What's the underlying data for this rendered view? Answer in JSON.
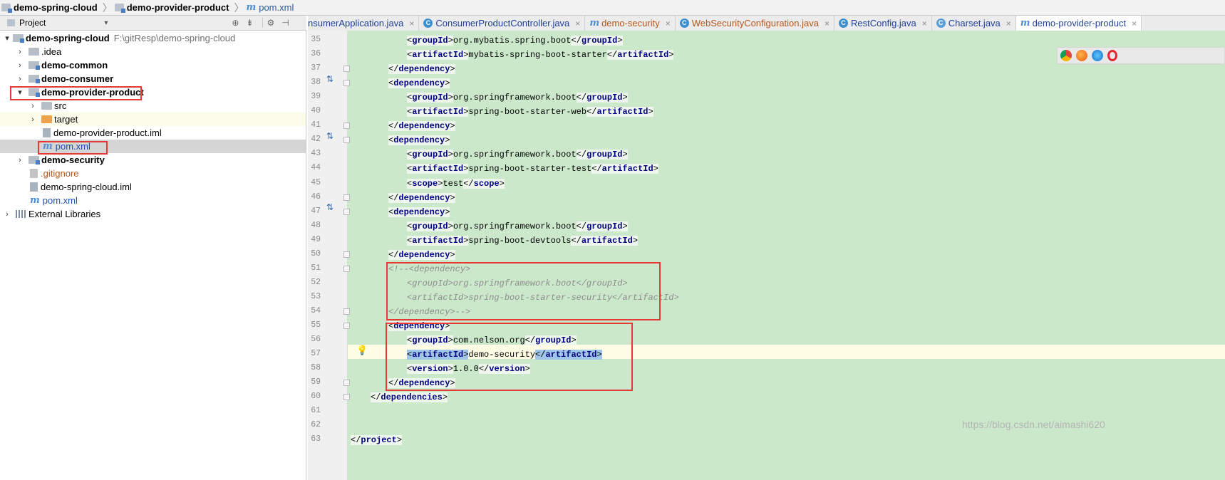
{
  "breadcrumb": {
    "items": [
      {
        "label": "demo-spring-cloud",
        "icon": "project-folder-icon"
      },
      {
        "label": "demo-provider-product",
        "icon": "module-folder-icon"
      },
      {
        "label": "pom.xml",
        "icon": "maven-file-icon"
      }
    ],
    "separator": "〉"
  },
  "project_panel": {
    "title": "Project",
    "dropdown_glyph": "▾",
    "toolbar_icons": [
      "target-icon",
      "collapse-icon",
      "gear-icon",
      "hide-panel-icon"
    ]
  },
  "tree": [
    {
      "label": "demo-spring-cloud",
      "suffix": "F:\\gitResp\\demo-spring-cloud",
      "arrow": "▾"
    },
    {
      "label": ".idea",
      "arrow": "›"
    },
    {
      "label": "demo-common",
      "arrow": "›"
    },
    {
      "label": "demo-consumer",
      "arrow": "›"
    },
    {
      "label": "demo-provider-product",
      "arrow": "▾"
    },
    {
      "label": "src",
      "arrow": "›"
    },
    {
      "label": "target",
      "arrow": "›"
    },
    {
      "label": "demo-provider-product.iml"
    },
    {
      "label": "pom.xml"
    },
    {
      "label": "demo-security",
      "arrow": "›"
    },
    {
      "label": ".gitignore"
    },
    {
      "label": "demo-spring-cloud.iml"
    },
    {
      "label": "pom.xml"
    },
    {
      "label": "External Libraries",
      "arrow": "›"
    }
  ],
  "tabs": [
    {
      "label": "nsumerApplication.java"
    },
    {
      "label": "ConsumerProductController.java"
    },
    {
      "label": "demo-security"
    },
    {
      "label": "WebSecurityConfiguration.java"
    },
    {
      "label": "RestConfig.java"
    },
    {
      "label": "Charset.java"
    },
    {
      "label": "demo-provider-product",
      "active": true
    }
  ],
  "tab_close_glyph": "×",
  "editor": {
    "lines": [
      {
        "n": "35",
        "parts": [
          [
            "i2",
            ""
          ],
          [
            "tag",
            "groupId"
          ],
          [
            "txt",
            "org.mybatis.spring.boot"
          ],
          [
            "ctag",
            "groupId"
          ]
        ]
      },
      {
        "n": "36",
        "parts": [
          [
            "i2",
            ""
          ],
          [
            "tag",
            "artifactId"
          ],
          [
            "txt",
            "mybatis-spring-boot-starter"
          ],
          [
            "ctag",
            "artifactId"
          ]
        ]
      },
      {
        "n": "37",
        "parts": [
          [
            "i1",
            ""
          ],
          [
            "ctag",
            "dependency"
          ]
        ]
      },
      {
        "n": "38",
        "parts": [
          [
            "i1",
            ""
          ],
          [
            "tag",
            "dependency"
          ]
        ]
      },
      {
        "n": "39",
        "parts": [
          [
            "i2",
            ""
          ],
          [
            "tag",
            "groupId"
          ],
          [
            "txt",
            "org.springframework.boot"
          ],
          [
            "ctag",
            "groupId"
          ]
        ]
      },
      {
        "n": "40",
        "parts": [
          [
            "i2",
            ""
          ],
          [
            "tag",
            "artifactId"
          ],
          [
            "txt",
            "spring-boot-starter-web"
          ],
          [
            "ctag",
            "artifactId"
          ]
        ]
      },
      {
        "n": "41",
        "parts": [
          [
            "i1",
            ""
          ],
          [
            "ctag",
            "dependency"
          ]
        ]
      },
      {
        "n": "42",
        "parts": [
          [
            "i1",
            ""
          ],
          [
            "tag",
            "dependency"
          ]
        ]
      },
      {
        "n": "43",
        "parts": [
          [
            "i2",
            ""
          ],
          [
            "tag",
            "groupId"
          ],
          [
            "txt",
            "org.springframework.boot"
          ],
          [
            "ctag",
            "groupId"
          ]
        ]
      },
      {
        "n": "44",
        "parts": [
          [
            "i2",
            ""
          ],
          [
            "tag",
            "artifactId"
          ],
          [
            "txt",
            "spring-boot-starter-test"
          ],
          [
            "ctag",
            "artifactId"
          ]
        ]
      },
      {
        "n": "45",
        "parts": [
          [
            "i2",
            ""
          ],
          [
            "tag",
            "scope"
          ],
          [
            "txt",
            "test"
          ],
          [
            "ctag",
            "scope"
          ]
        ]
      },
      {
        "n": "46",
        "parts": [
          [
            "i1",
            ""
          ],
          [
            "ctag",
            "dependency"
          ]
        ]
      },
      {
        "n": "47",
        "parts": [
          [
            "i1",
            ""
          ],
          [
            "tag",
            "dependency"
          ]
        ]
      },
      {
        "n": "48",
        "parts": [
          [
            "i2",
            ""
          ],
          [
            "tag",
            "groupId"
          ],
          [
            "txt",
            "org.springframework.boot"
          ],
          [
            "ctag",
            "groupId"
          ]
        ]
      },
      {
        "n": "49",
        "parts": [
          [
            "i2",
            ""
          ],
          [
            "tag",
            "artifactId"
          ],
          [
            "txt",
            "spring-boot-devtools"
          ],
          [
            "ctag",
            "artifactId"
          ]
        ]
      },
      {
        "n": "50",
        "parts": [
          [
            "i1",
            ""
          ],
          [
            "ctag",
            "dependency"
          ]
        ]
      },
      {
        "n": "51",
        "parts": [
          [
            "i1",
            ""
          ],
          [
            "cm",
            "<!--<dependency>"
          ]
        ]
      },
      {
        "n": "52",
        "parts": [
          [
            "i2",
            ""
          ],
          [
            "cm",
            "<groupId>org.springframework.boot</groupId>"
          ]
        ]
      },
      {
        "n": "53",
        "parts": [
          [
            "i2",
            ""
          ],
          [
            "cm",
            "<artifactId>spring-boot-starter-security</artifactId>"
          ]
        ]
      },
      {
        "n": "54",
        "parts": [
          [
            "i1",
            ""
          ],
          [
            "cm",
            "</dependency>-->"
          ]
        ]
      },
      {
        "n": "55",
        "parts": [
          [
            "i1",
            ""
          ],
          [
            "tag",
            "dependency"
          ]
        ]
      },
      {
        "n": "56",
        "parts": [
          [
            "i2",
            ""
          ],
          [
            "tag",
            "groupId"
          ],
          [
            "txt",
            "com.nelson.org"
          ],
          [
            "ctag",
            "groupId"
          ]
        ]
      },
      {
        "n": "57",
        "parts": [
          [
            "i2",
            ""
          ],
          [
            "tagh",
            "artifactId"
          ],
          [
            "txt",
            "demo-security"
          ],
          [
            "ctagh",
            "artifactId"
          ]
        ]
      },
      {
        "n": "58",
        "parts": [
          [
            "i2",
            ""
          ],
          [
            "tag",
            "version"
          ],
          [
            "txt",
            "1.0.0"
          ],
          [
            "ctag",
            "version"
          ]
        ]
      },
      {
        "n": "59",
        "parts": [
          [
            "i1",
            ""
          ],
          [
            "ctag",
            "dependency"
          ]
        ]
      },
      {
        "n": "60",
        "parts": [
          [
            "i0",
            ""
          ],
          [
            "ctag",
            "dependencies"
          ]
        ]
      },
      {
        "n": "61",
        "parts": []
      },
      {
        "n": "62",
        "parts": []
      },
      {
        "n": "63",
        "parts": [
          [
            "ctag",
            "project"
          ]
        ]
      }
    ]
  },
  "watermark": "https://blog.csdn.net/aimashi620",
  "browser_icons": [
    "chrome-icon",
    "firefox-icon",
    "safari-icon",
    "opera-icon"
  ]
}
